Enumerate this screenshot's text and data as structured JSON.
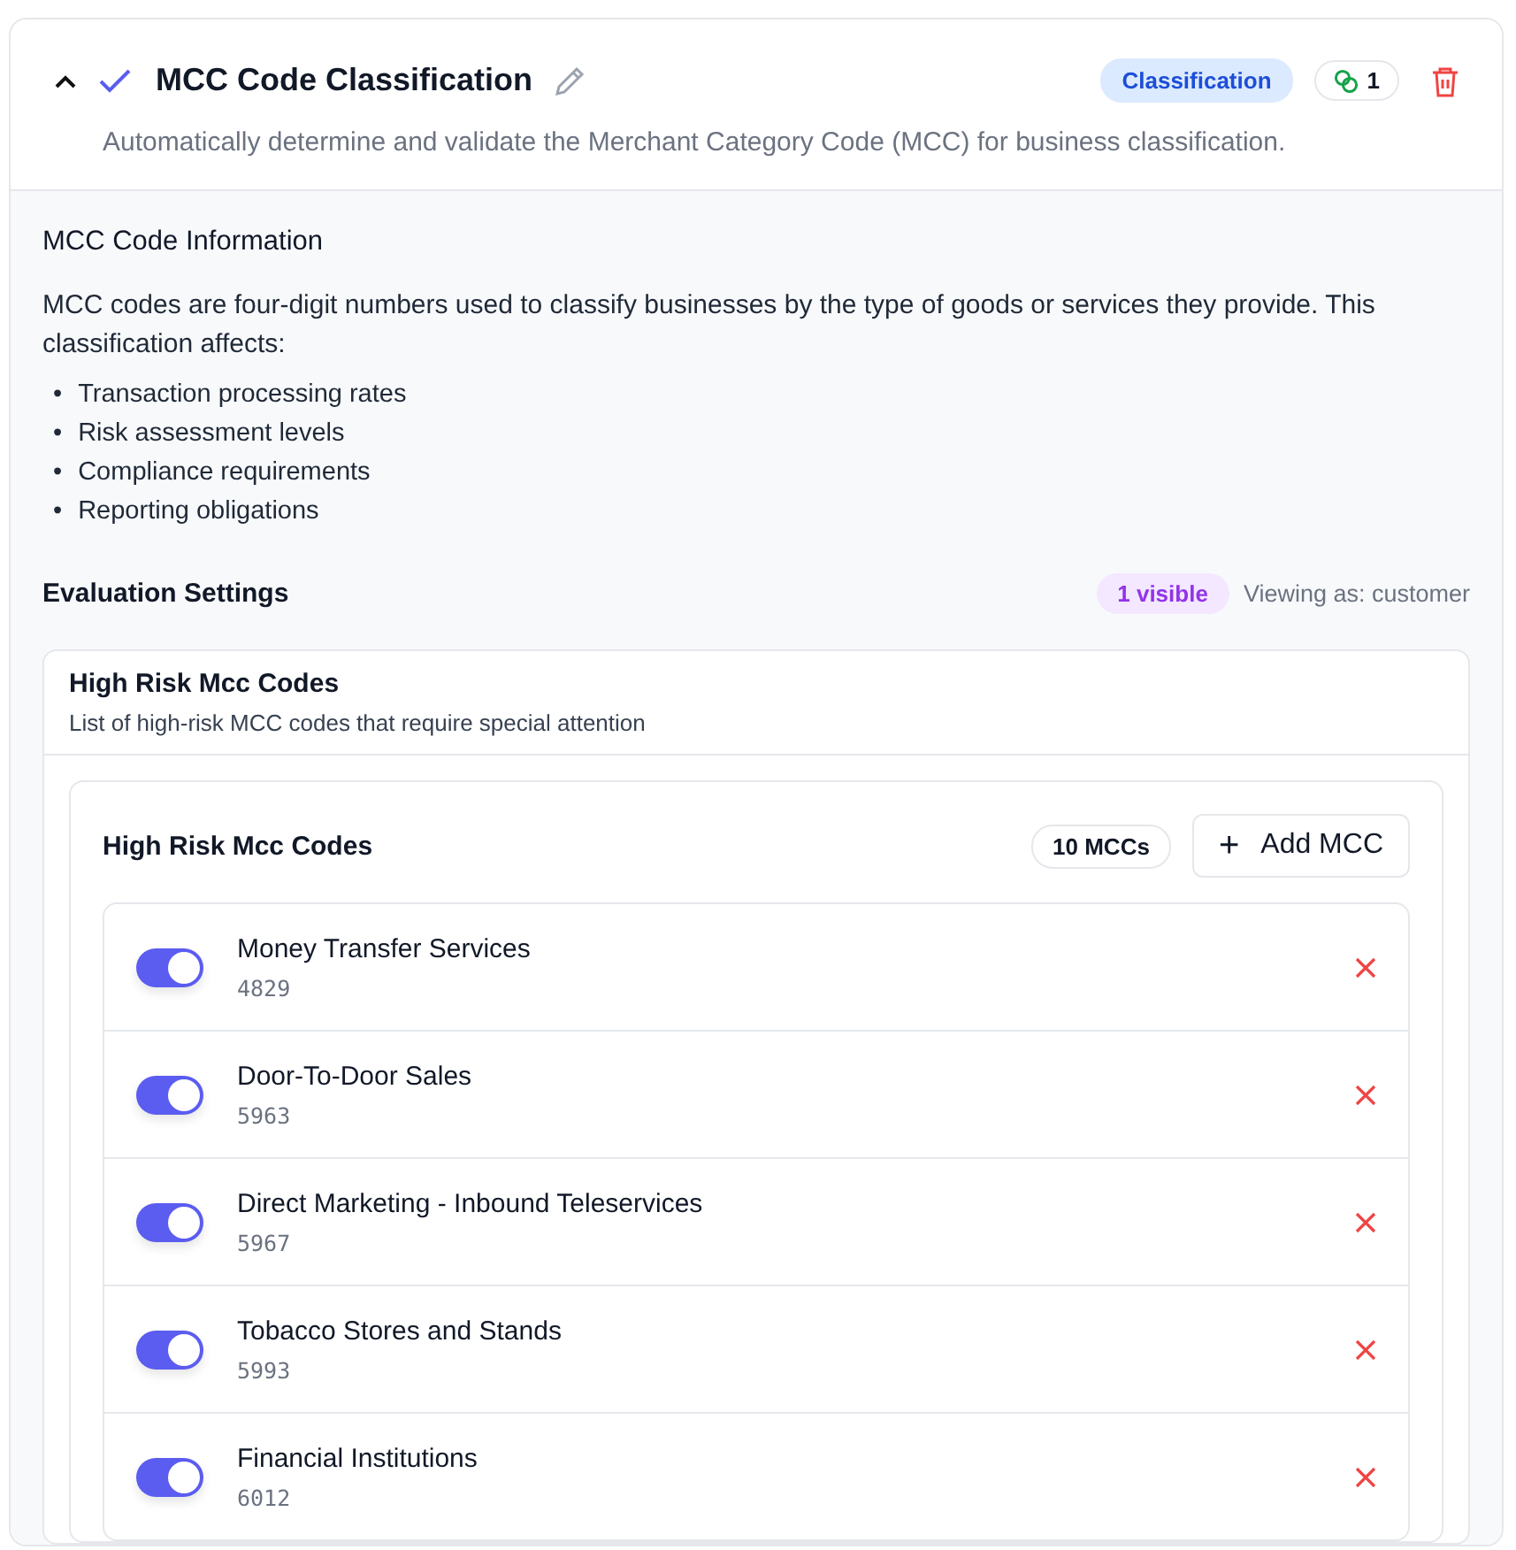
{
  "header": {
    "expanded": true,
    "checked": true,
    "title": "MCC Code Classification",
    "description": "Automatically determine and validate the Merchant Category Code (MCC) for business classification.",
    "tag": "Classification",
    "count": "1"
  },
  "info": {
    "title": "MCC Code Information",
    "text": "MCC codes are four-digit numbers used to classify businesses by the type of goods or services they provide. This classification affects:",
    "bullets": [
      {
        "marker": "•",
        "text": "Transaction processing rates"
      },
      {
        "marker": "•",
        "text": "Risk assessment levels"
      },
      {
        "marker": "•",
        "text": "Compliance requirements"
      },
      {
        "marker": "•",
        "text": "Reporting obligations"
      }
    ]
  },
  "settings": {
    "title": "Evaluation Settings",
    "visible_badge": "1 visible",
    "viewing_as": "Viewing as: customer"
  },
  "setting": {
    "title": "High Risk Mcc Codes",
    "description": "List of high-risk MCC codes that require special attention",
    "list_title": "High Risk Mcc Codes",
    "count_badge": "10 MCCs",
    "add_button": "Add MCC",
    "add_icon": "+",
    "items": [
      {
        "name": "Money Transfer Services",
        "code": "4829",
        "on": true
      },
      {
        "name": "Door-To-Door Sales",
        "code": "5963",
        "on": true
      },
      {
        "name": "Direct Marketing - Inbound Teleservices",
        "code": "5967",
        "on": true
      },
      {
        "name": "Tobacco Stores and Stands",
        "code": "5993",
        "on": true
      },
      {
        "name": "Financial Institutions",
        "code": "6012",
        "on": true
      }
    ]
  }
}
